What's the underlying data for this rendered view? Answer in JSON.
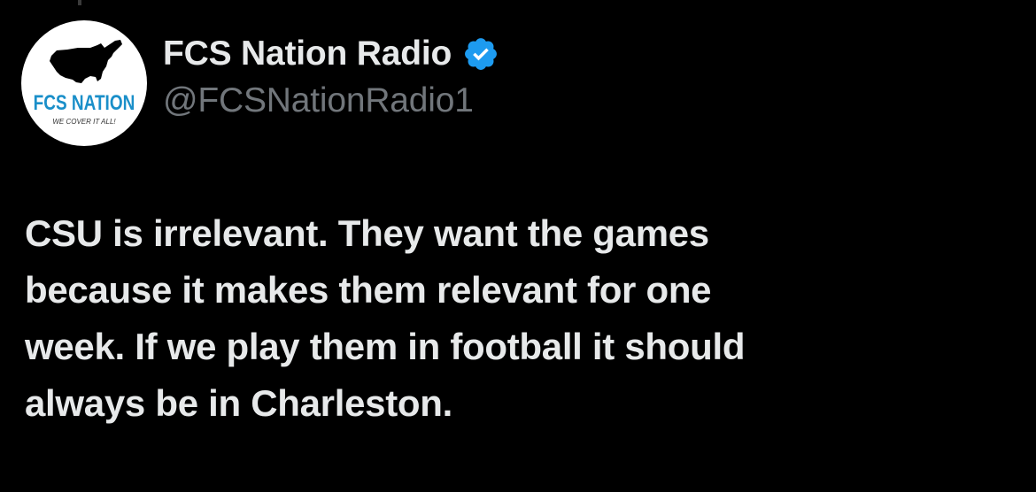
{
  "author": {
    "display_name": "FCS Nation Radio",
    "handle": "@FCSNationRadio1",
    "verified": true,
    "verified_icon": "verified-badge-icon",
    "avatar": {
      "logo_title": "FCS NATION",
      "logo_tagline": "WE COVER IT ALL!",
      "logo_icon": "usa-map-icon"
    }
  },
  "tweet": {
    "text_lines": [
      "CSU is irrelevant. They want the games",
      "because it makes them relevant for one",
      "week. If we play them in football it should",
      "always be in Charleston."
    ]
  },
  "colors": {
    "background": "#000000",
    "primary_text": "#e7e9ea",
    "secondary_text": "#71767b",
    "verified_blue": "#1d9bf0",
    "logo_blue": "#1a8fc9"
  }
}
